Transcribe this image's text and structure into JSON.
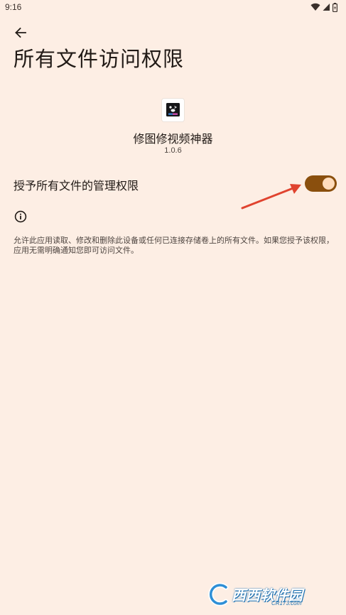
{
  "status_bar": {
    "time": "9:16",
    "icons": [
      "wifi-icon",
      "signal-icon",
      "battery-icon"
    ]
  },
  "header": {
    "back_icon": "arrow-left-icon",
    "title": "所有文件访问权限"
  },
  "app": {
    "name": "修图修视频神器",
    "version": "1.0.6"
  },
  "setting": {
    "label": "授予所有文件的管理权限",
    "enabled": true
  },
  "info": {
    "icon": "info-icon",
    "description": "允许此应用读取、修改和删除此设备或任何已连接存储卷上的所有文件。如果您授予该权限，应用无需明确通知您即可访问文件。"
  },
  "watermark": {
    "brand": "西西软件园",
    "url": "CR173.com"
  },
  "colors": {
    "background": "#fdeee4",
    "switch_track": "#8a4f0d",
    "switch_thumb": "#ffdcbc",
    "annotation_arrow": "#e0432f"
  }
}
